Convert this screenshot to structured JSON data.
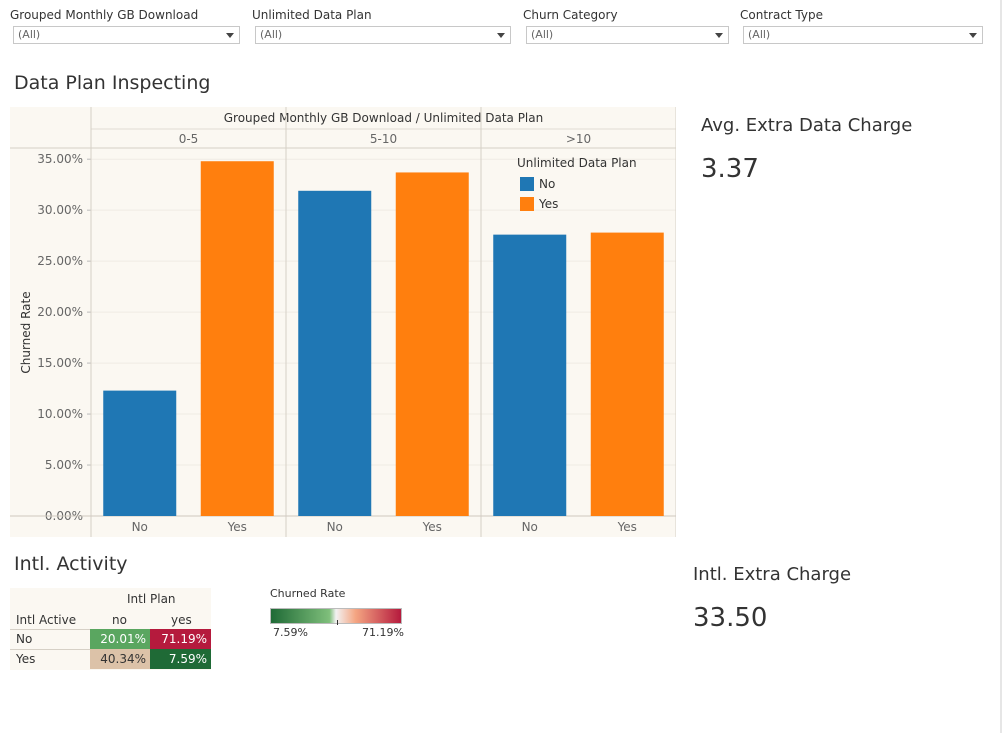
{
  "filters": [
    {
      "label": "Grouped Monthly GB Download",
      "value": "(All)"
    },
    {
      "label": "Unlimited Data Plan",
      "value": "(All)"
    },
    {
      "label": "Churn Category",
      "value": "(All)"
    },
    {
      "label": "Contract Type",
      "value": "(All)"
    }
  ],
  "data_plan": {
    "title": "Data Plan Inspecting"
  },
  "kpi_data": {
    "title": "Avg. Extra Data Charge",
    "value": "3.37"
  },
  "intl": {
    "title": "Intl. Activity",
    "table": {
      "column_group": "Intl Plan",
      "row_header": "Intl Active",
      "columns": [
        "no",
        "yes"
      ],
      "rows": [
        {
          "label": "No",
          "values": [
            "20.01%",
            "71.19%"
          ],
          "colors": [
            "#5aa660",
            "#b51a3d"
          ]
        },
        {
          "label": "Yes",
          "values": [
            "40.34%",
            "7.59%"
          ],
          "colors": [
            "#dcc2a8",
            "#1f6a36"
          ]
        }
      ]
    },
    "legend": {
      "title": "Churned Rate",
      "min": "7.59%",
      "max": "71.19%"
    }
  },
  "kpi_intl": {
    "title": "Intl. Extra Charge",
    "value": "33.50"
  },
  "chart_data": {
    "type": "bar",
    "header": "Grouped Monthly GB Download  /  Unlimited Data Plan",
    "groups": [
      "0-5",
      "5-10",
      ">10"
    ],
    "categories": [
      "No",
      "Yes"
    ],
    "ylabel": "Churned Rate",
    "ylim": [
      0,
      0.36
    ],
    "yticks": [
      "0.00%",
      "5.00%",
      "10.00%",
      "15.00%",
      "20.00%",
      "25.00%",
      "30.00%",
      "35.00%"
    ],
    "values": [
      [
        0.123,
        0.348
      ],
      [
        0.319,
        0.337
      ],
      [
        0.276,
        0.278
      ]
    ],
    "colors": {
      "No": "#1f77b4",
      "Yes": "#ff7f0e"
    },
    "legend": {
      "title": "Unlimited Data Plan",
      "entries": [
        "No",
        "Yes"
      ],
      "position": "top-right"
    },
    "grid": true
  }
}
